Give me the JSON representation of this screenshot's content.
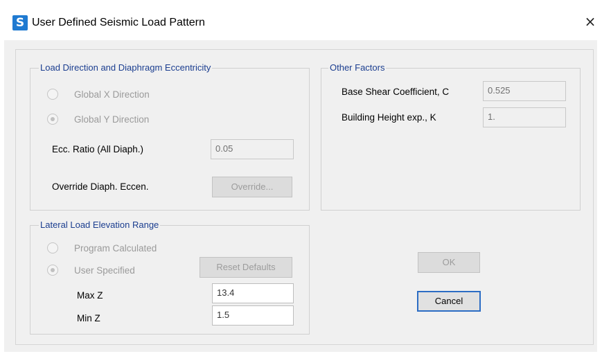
{
  "window": {
    "title": "User Defined Seismic Load Pattern",
    "app_icon_letter": "S",
    "close_glyph": "×"
  },
  "load_direction": {
    "title": "Load Direction and Diaphragm Eccentricity",
    "global_x_label": "Global  X  Direction",
    "global_y_label": "Global  Y  Direction",
    "selected": "Global Y Direction",
    "ecc_ratio_label": "Ecc. Ratio (All Diaph.)",
    "ecc_ratio_value": "0.05",
    "override_label": "Override Diaph. Eccen.",
    "override_button": "Override..."
  },
  "other_factors": {
    "title": "Other Factors",
    "base_shear_label": "Base Shear Coefficient, C",
    "base_shear_value": "0.525",
    "building_height_label": "Building Height exp., K",
    "building_height_value": "1."
  },
  "lateral_load": {
    "title": "Lateral Load Elevation Range",
    "program_calculated_label": "Program Calculated",
    "user_specified_label": "User Specified",
    "selected": "User Specified",
    "reset_defaults_button": "Reset Defaults",
    "max_z_label": "Max Z",
    "max_z_value": "13.4",
    "min_z_label": "Min Z",
    "min_z_value": "1.5"
  },
  "buttons": {
    "ok": "OK",
    "cancel": "Cancel"
  },
  "colors": {
    "group_title": "#1a3d8f",
    "app_icon": "#1f7ad1",
    "dialog_background": "#f0f0f0",
    "focus_border": "#2b6cc4"
  }
}
